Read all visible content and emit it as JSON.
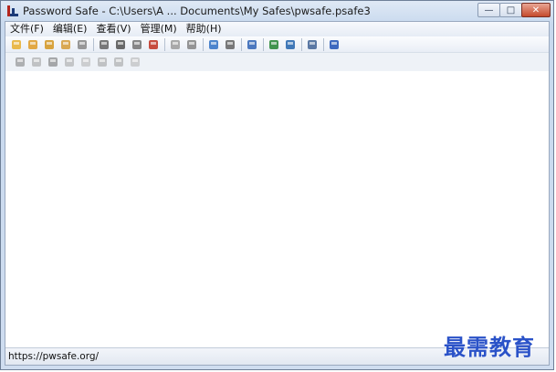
{
  "window": {
    "title": "Password Safe - C:\\Users\\A ... Documents\\My Safes\\pwsafe.psafe3"
  },
  "menu": [
    {
      "label": "文件(F)"
    },
    {
      "label": "编辑(E)"
    },
    {
      "label": "查看(V)"
    },
    {
      "label": "管理(M)"
    },
    {
      "label": "帮助(H)"
    }
  ],
  "toolbar1": [
    {
      "icon": "new-safe-icon",
      "color": "#e8b23a"
    },
    {
      "icon": "open-safe-icon",
      "color": "#e0a030"
    },
    {
      "icon": "close-safe-icon",
      "color": "#d59a2a"
    },
    {
      "icon": "lock-safe-icon",
      "color": "#d6a040"
    },
    {
      "icon": "save-icon",
      "color": "#8d8d8d"
    },
    {
      "sep": true
    },
    {
      "icon": "copy-password-icon",
      "color": "#6a6a6a"
    },
    {
      "icon": "copy-username-icon",
      "color": "#5a5a5a"
    },
    {
      "icon": "copy-notes-icon",
      "color": "#7a7a7a"
    },
    {
      "icon": "clear-clipboard-icon",
      "color": "#c23a2a"
    },
    {
      "sep": true
    },
    {
      "icon": "autotype-icon",
      "color": "#a0a0a0"
    },
    {
      "icon": "browse-url-icon",
      "color": "#8a8a8a"
    },
    {
      "sep": true
    },
    {
      "icon": "add-entry-icon",
      "color": "#3a78c8"
    },
    {
      "icon": "edit-entry-icon",
      "color": "#6a6a6a"
    },
    {
      "sep": true
    },
    {
      "icon": "delete-entry-icon",
      "color": "#3a6ab8"
    },
    {
      "sep": true
    },
    {
      "icon": "expand-all-icon",
      "color": "#2e8a3c"
    },
    {
      "icon": "collapse-all-icon",
      "color": "#2e6ab0"
    },
    {
      "sep": true
    },
    {
      "icon": "options-icon",
      "color": "#4a6a9a"
    },
    {
      "sep": true
    },
    {
      "icon": "help-icon",
      "color": "#2a5ab8"
    }
  ],
  "toolbar2": [
    {
      "icon": "add-group-icon",
      "color": "#7a7a7a"
    },
    {
      "icon": "tag-icon",
      "color": "#9a9a9a"
    },
    {
      "icon": "users-icon",
      "color": "#6a6a6a"
    },
    {
      "icon": "key-icon",
      "color": "#a0a0a0"
    },
    {
      "icon": "note-icon",
      "color": "#b0b0b0"
    },
    {
      "icon": "record-icon",
      "color": "#9a9a9a"
    },
    {
      "icon": "email-icon",
      "color": "#9a9a9a"
    },
    {
      "icon": "print-icon",
      "color": "#b0b0b0"
    }
  ],
  "status": {
    "text": "https://pwsafe.org/"
  },
  "watermark": {
    "text": "最需教育",
    "color": "#2a52c8"
  }
}
